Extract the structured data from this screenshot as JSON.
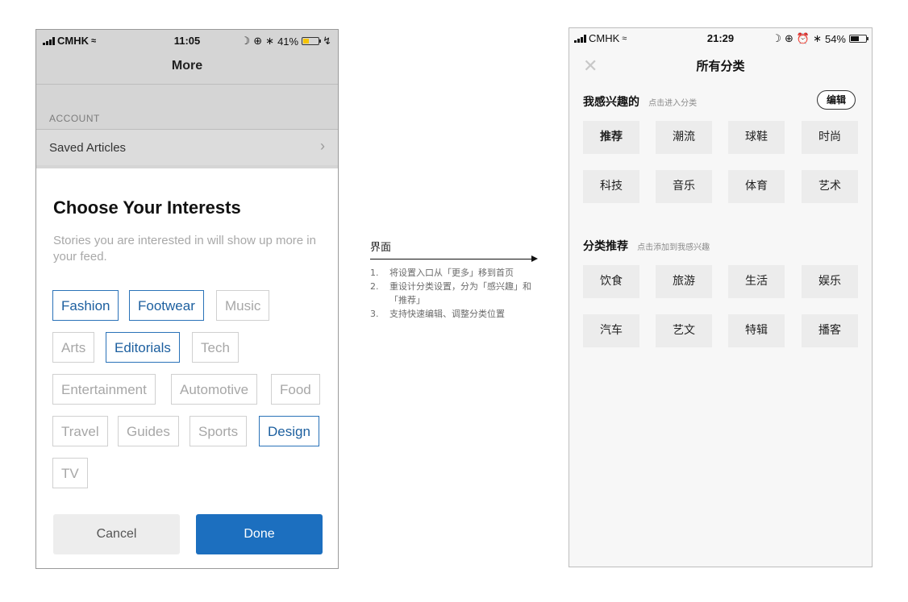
{
  "left_phone": {
    "status": {
      "carrier": "CMHK",
      "time": "11:05",
      "battery": "41%",
      "battery_level": 0.41
    },
    "nav_title": "More",
    "account_header": "ACCOUNT",
    "saved_articles": "Saved Articles",
    "sheet": {
      "title": "Choose Your Interests",
      "subtitle": "Stories you are interested in will show up more in your feed.",
      "chips": [
        {
          "label": "Fashion",
          "selected": true
        },
        {
          "label": "Footwear",
          "selected": true
        },
        {
          "label": "Music",
          "selected": false
        },
        {
          "label": "Arts",
          "selected": false
        },
        {
          "label": "Editorials",
          "selected": true
        },
        {
          "label": "Tech",
          "selected": false
        },
        {
          "label": "Entertainment",
          "selected": false
        },
        {
          "label": "Automotive",
          "selected": false
        },
        {
          "label": "Food",
          "selected": false
        },
        {
          "label": "Travel",
          "selected": false
        },
        {
          "label": "Guides",
          "selected": false
        },
        {
          "label": "Sports",
          "selected": false
        },
        {
          "label": "Design",
          "selected": true
        },
        {
          "label": "TV",
          "selected": false
        }
      ],
      "cancel_label": "Cancel",
      "done_label": "Done"
    }
  },
  "annotation": {
    "title": "界面",
    "items": [
      {
        "num": "1.",
        "text": "将设置入口从「更多」移到首页"
      },
      {
        "num": "2.",
        "text": "重设计分类设置，分为「感兴趣」和「推荐」"
      },
      {
        "num": "3.",
        "text": "支持快速编辑、调整分类位置"
      }
    ]
  },
  "right_phone": {
    "status": {
      "carrier": "CMHK",
      "time": "21:29",
      "battery": "54%",
      "battery_level": 0.54
    },
    "title": "所有分类",
    "interests": {
      "heading": "我感兴趣的",
      "hint": "点击进入分类",
      "edit_label": "编辑",
      "tiles": [
        "推荐",
        "潮流",
        "球鞋",
        "时尚",
        "科技",
        "音乐",
        "体育",
        "艺术"
      ]
    },
    "recommend": {
      "heading": "分类推荐",
      "hint": "点击添加到我感兴趣",
      "tiles": [
        "饮食",
        "旅游",
        "生活",
        "娱乐",
        "汽车",
        "艺文",
        "特辑",
        "播客"
      ]
    }
  },
  "colors": {
    "accent": "#1c6fbf",
    "chip_selected": "#2a72b8",
    "overlay": "#d5d5d5"
  }
}
